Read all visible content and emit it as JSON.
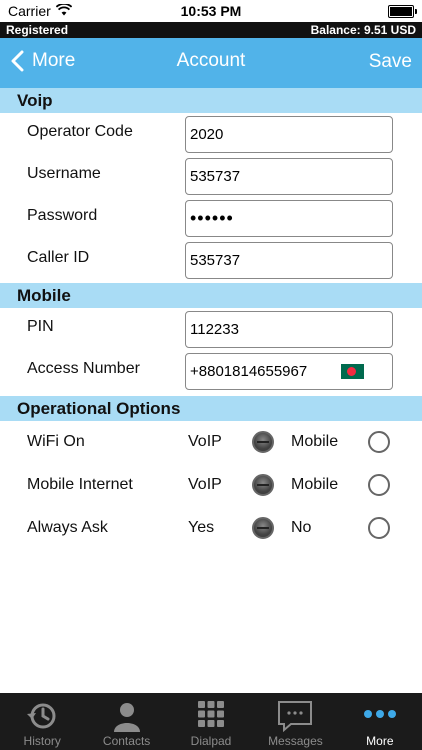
{
  "status": {
    "carrier": "Carrier",
    "time": "10:53 PM"
  },
  "topbar": {
    "registered": "Registered",
    "balance": "Balance: 9.51 USD"
  },
  "nav": {
    "back_label": "More",
    "title": "Account",
    "save_label": "Save"
  },
  "voip": {
    "header": "Voip",
    "operator_code": {
      "label": "Operator Code",
      "value": "2020"
    },
    "username": {
      "label": "Username",
      "value": "535737"
    },
    "password": {
      "label": "Password",
      "value": "••••••"
    },
    "caller_id": {
      "label": "Caller ID",
      "value": "535737"
    }
  },
  "mobile": {
    "header": "Mobile",
    "pin": {
      "label": "PIN",
      "value": "112233"
    },
    "access_number": {
      "label": "Access Number",
      "value": "+8801814655967"
    }
  },
  "options": {
    "header": "Operational Options",
    "rows": [
      {
        "label": "WiFi On",
        "opt1": "VoIP",
        "opt2": "Mobile",
        "selected": 1
      },
      {
        "label": "Mobile Internet",
        "opt1": "VoIP",
        "opt2": "Mobile",
        "selected": 1
      },
      {
        "label": "Always Ask",
        "opt1": "Yes",
        "opt2": "No",
        "selected": 1
      }
    ]
  },
  "tabs": [
    {
      "label": "History",
      "icon": "history-icon"
    },
    {
      "label": "Contacts",
      "icon": "contacts-icon"
    },
    {
      "label": "Dialpad",
      "icon": "dialpad-icon"
    },
    {
      "label": "Messages",
      "icon": "messages-icon"
    },
    {
      "label": "More",
      "icon": "more-icon",
      "active": true
    }
  ]
}
